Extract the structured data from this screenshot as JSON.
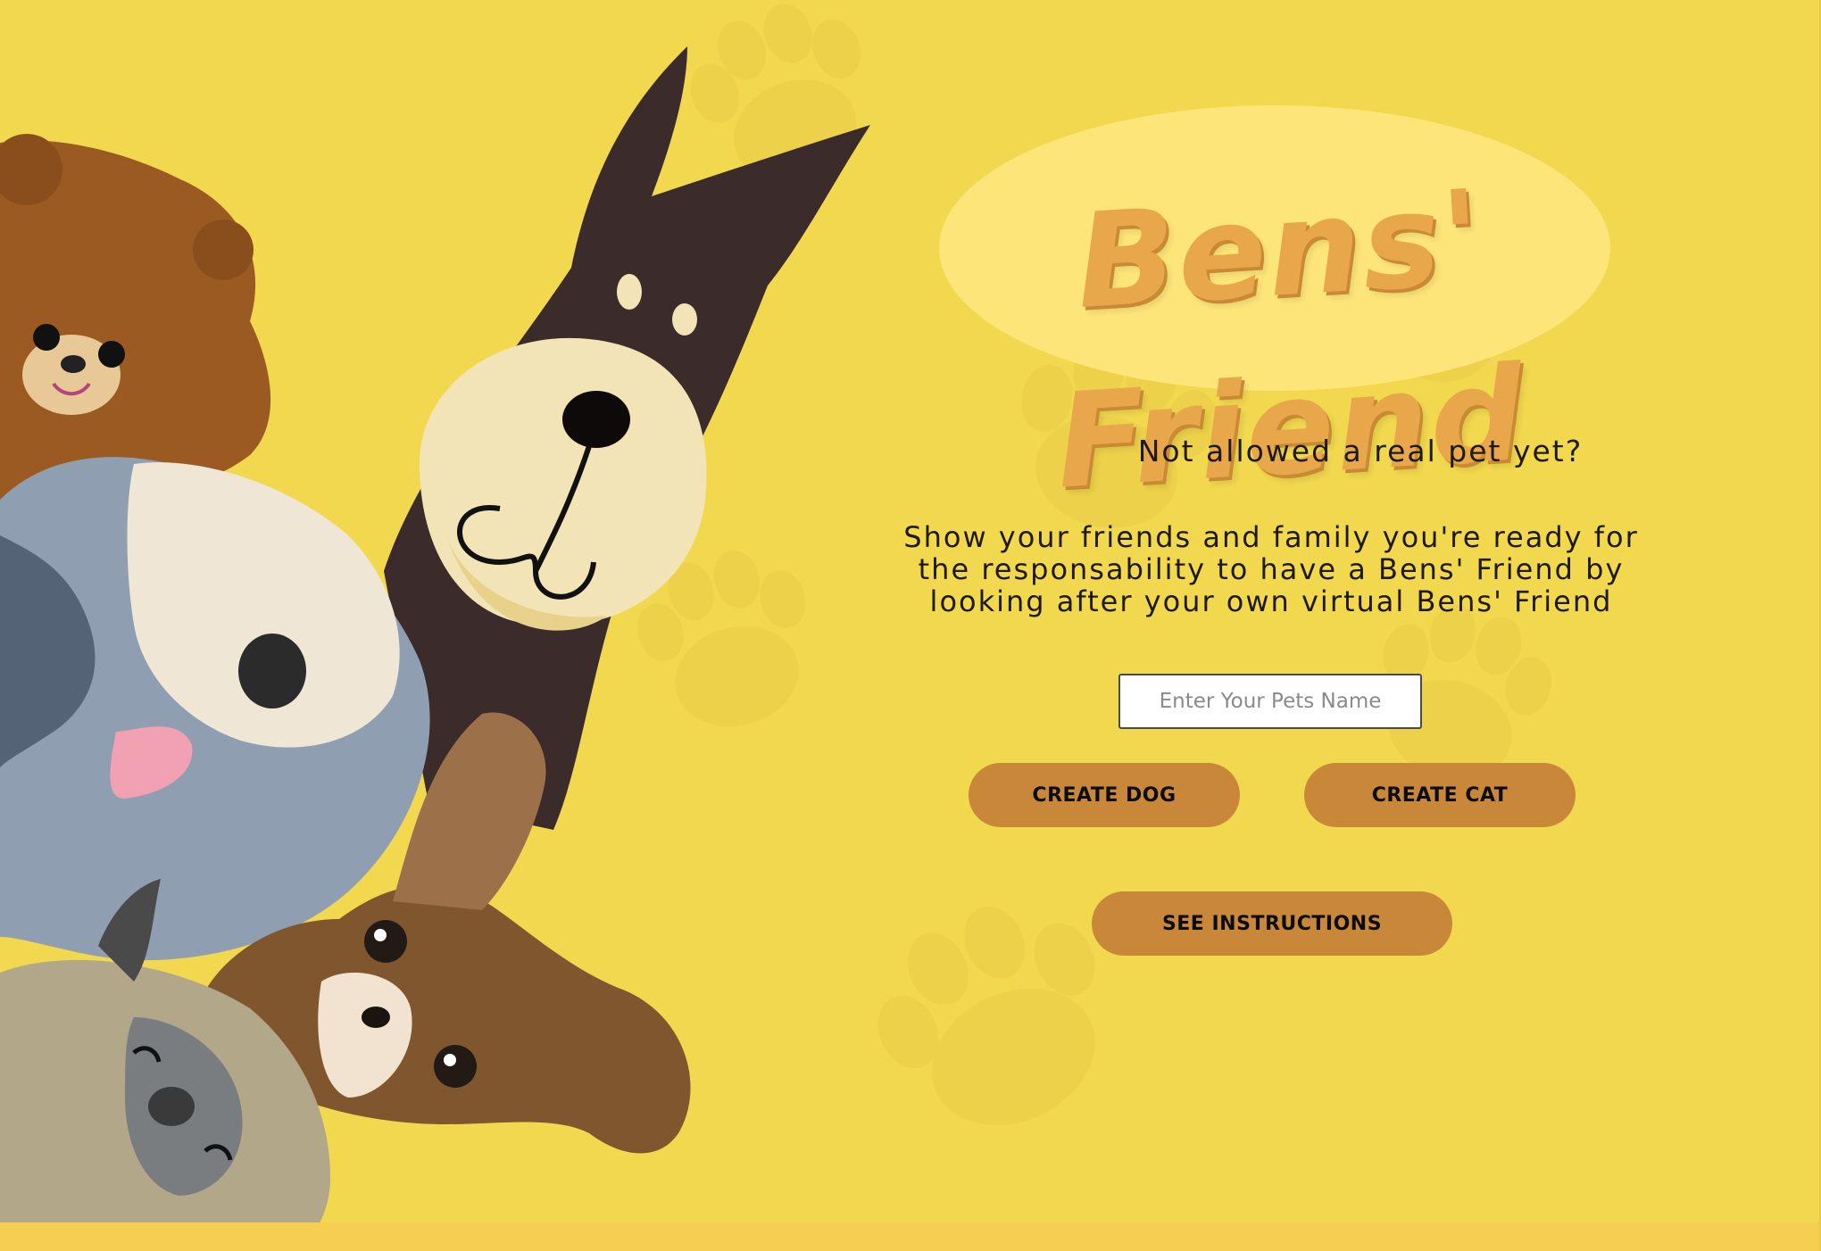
{
  "title": "Bens' Friend",
  "tagline": "Not allowed a real pet yet?",
  "description_lines": [
    "Show your friends and family you're ready for",
    "the responsability to have a Bens' Friend by",
    "looking after your own virtual Bens' Friend"
  ],
  "pet_name_input": {
    "placeholder": "Enter Your Pets Name",
    "value": ""
  },
  "buttons": {
    "create_dog": "CREATE DOG",
    "create_cat": "CREATE CAT",
    "see_instructions": "SEE INSTRUCTIONS"
  },
  "colors": {
    "background": "#f1d84f",
    "title": "#e8a74b",
    "title_highlight": "#fde57a",
    "button": "#c9873a",
    "paw_print": "#e9cc48"
  },
  "illustration": {
    "animals": [
      "teddy-bear",
      "doberman-dog",
      "grey-shaggy-dog",
      "brown-chihuahua",
      "pug-dog"
    ]
  }
}
